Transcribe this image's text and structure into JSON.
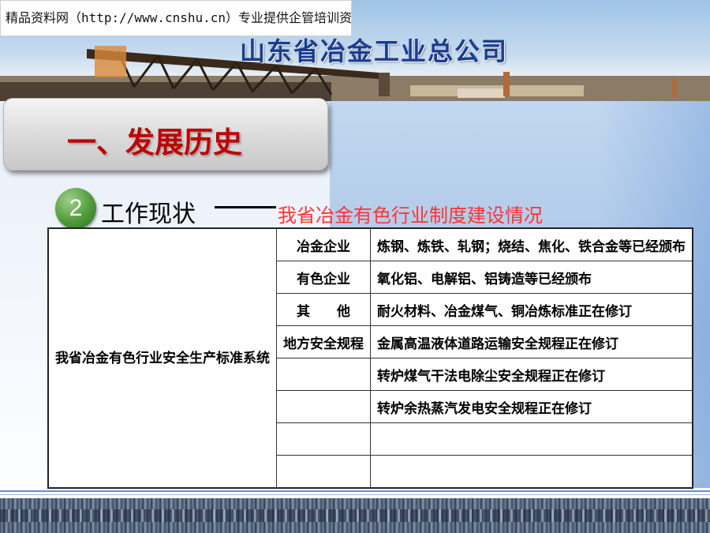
{
  "watermark": "精品资料网（http://www.cnshu.cn）专业提供企管培训资料",
  "company_name": "山东省冶金工业总公司",
  "section_title": "一、发展历史",
  "subtitle": {
    "number": "2",
    "main": "工作现状",
    "detail": "我省冶金有色行业制度建设情况"
  },
  "table": {
    "row_header": "我省冶金有色行业安全生产标准系统",
    "rows": [
      {
        "category": "冶金企业",
        "description": "炼钢、炼铁、轧钢；烧结、焦化、铁合金等已经颁布"
      },
      {
        "category": "有色企业",
        "description": "氧化铝、电解铝、铝铸造等已经颁布"
      },
      {
        "category": "其　　他",
        "description": "耐火材料、冶金煤气、铜冶炼标准正在修订"
      },
      {
        "category": "地方安全规程",
        "description": "金属高温液体道路运输安全规程正在修订"
      },
      {
        "category": "",
        "description": "转炉煤气干法电除尘安全规程正在修订"
      },
      {
        "category": "",
        "description": "转炉余热蒸汽发电安全规程正在修订"
      },
      {
        "category": "",
        "description": ""
      },
      {
        "category": "",
        "description": ""
      }
    ]
  },
  "colors": {
    "section_title": "#c00000",
    "subtitle_detail": "#ff3333",
    "company_name": "#1a3d8f",
    "number_circle": "#4f9a3a"
  }
}
